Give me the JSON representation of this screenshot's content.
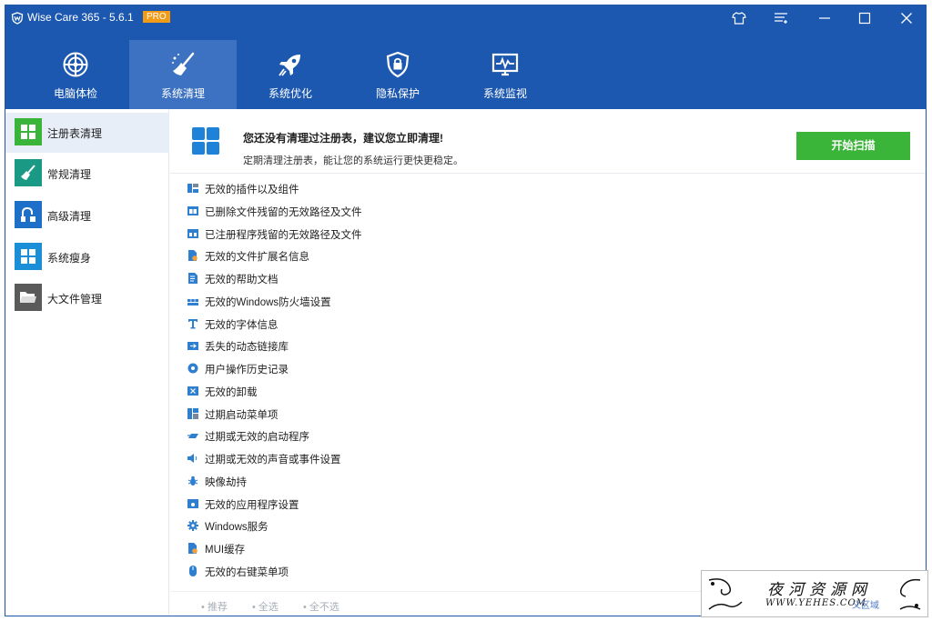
{
  "window": {
    "title": "Wise Care 365 - 5.6.1",
    "badge": "PRO"
  },
  "nav": {
    "tabs": [
      {
        "label": "电脑体检",
        "icon": "radar-icon"
      },
      {
        "label": "系统清理",
        "icon": "broom-icon",
        "active": true
      },
      {
        "label": "系统优化",
        "icon": "rocket-icon"
      },
      {
        "label": "隐私保护",
        "icon": "shield-lock-icon"
      },
      {
        "label": "系统监视",
        "icon": "monitor-pulse-icon"
      }
    ]
  },
  "sidebar": {
    "items": [
      {
        "label": "注册表清理",
        "icon": "registry-icon",
        "color": "#3bb43a",
        "active": true
      },
      {
        "label": "常规清理",
        "icon": "broom-icon",
        "color": "#1a9a85"
      },
      {
        "label": "高级清理",
        "icon": "advanced-clean-icon",
        "color": "#1e6fc7"
      },
      {
        "label": "系统瘦身",
        "icon": "windows-icon",
        "color": "#1a8fd8"
      },
      {
        "label": "大文件管理",
        "icon": "folder-icon",
        "color": "#5a5a5a"
      }
    ]
  },
  "banner": {
    "title": "您还没有清理过注册表，建议您立即清理!",
    "subtitle": "定期清理注册表，能让您的系统运行更快更稳定。",
    "scan_button": "开始扫描"
  },
  "items": [
    {
      "label": "无效的插件以及组件",
      "icon": "plugin-icon"
    },
    {
      "label": "已删除文件残留的无效路径及文件",
      "icon": "deleted-file-icon"
    },
    {
      "label": "已注册程序残留的无效路径及文件",
      "icon": "program-icon"
    },
    {
      "label": "无效的文件扩展名信息",
      "icon": "file-extension-icon"
    },
    {
      "label": "无效的帮助文档",
      "icon": "help-doc-icon"
    },
    {
      "label": "无效的Windows防火墙设置",
      "icon": "firewall-icon"
    },
    {
      "label": "无效的字体信息",
      "icon": "font-icon"
    },
    {
      "label": "丢失的动态链接库",
      "icon": "dll-icon"
    },
    {
      "label": "用户操作历史记录",
      "icon": "history-icon"
    },
    {
      "label": "无效的卸载",
      "icon": "uninstall-icon"
    },
    {
      "label": "过期启动菜单项",
      "icon": "start-menu-icon"
    },
    {
      "label": "过期或无效的启动程序",
      "icon": "startup-icon"
    },
    {
      "label": "过期或无效的声音或事件设置",
      "icon": "sound-icon"
    },
    {
      "label": "映像劫持",
      "icon": "bug-icon"
    },
    {
      "label": "无效的应用程序设置",
      "icon": "app-settings-icon"
    },
    {
      "label": "Windows服务",
      "icon": "gear-icon"
    },
    {
      "label": "MUI缓存",
      "icon": "mui-cache-icon"
    },
    {
      "label": "无效的右键菜单项",
      "icon": "mouse-icon"
    }
  ],
  "footer": {
    "recommend": "• 推荐",
    "select_all": "• 全选",
    "select_none": "• 全不选"
  },
  "watermark": {
    "title": "夜河资源网",
    "url": "WWW.YEHES.COM",
    "extra": "义区域"
  },
  "colors": {
    "titlebar": "#1d58b0",
    "active_tab": "#3c72c1",
    "scan_button": "#3bb43a",
    "pro_badge": "#f29b18"
  }
}
